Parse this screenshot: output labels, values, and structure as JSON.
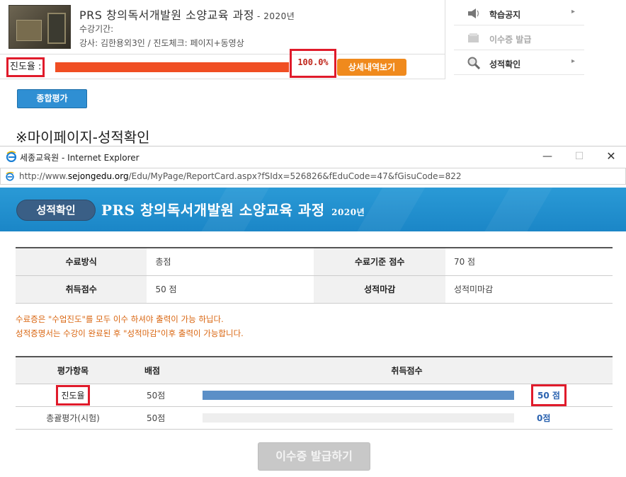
{
  "course": {
    "title": "PRS 창의독서개발원 소양교육 과정",
    "year": "- 2020년",
    "period": "수강기간:",
    "teacher": "강사: 김한용외3인 / 진도체크: 페이지+동영상",
    "progress_label": "진도율 :",
    "progress_percent": "100.0%",
    "progress_value": 100,
    "detail_button": "상세내역보기",
    "eval_button": "종합평가"
  },
  "side_menu": {
    "items": [
      {
        "label": "학습공지",
        "icon": "speaker-icon",
        "arrow": "▸"
      },
      {
        "label": "이수증 발급",
        "icon": "certificate-icon"
      },
      {
        "label": "성적확인",
        "icon": "magnifier-icon",
        "arrow": "▸"
      }
    ]
  },
  "caption": "※마이페이지-성적확인",
  "ie": {
    "window_title": "세종교육원 - Internet Explorer",
    "url_prefix": "http://www.",
    "url_domain": "sejongedu.org",
    "url_rest": "/Edu/MyPage/ReportCard.aspx?fSIdx=526826&fEduCode=47&fGisuCode=822",
    "minimize": "—",
    "maximize": "☐",
    "close": "✕"
  },
  "report": {
    "pill": "성적확인",
    "title": "PRS 창의독서개발원 소양교육 과정",
    "year": "2020년",
    "info": {
      "method_label": "수료방식",
      "method_value": "총점",
      "criteria_label": "수료기준 점수",
      "criteria_value": "70 점",
      "score_label": "취득점수",
      "score_value": "50 점",
      "closing_label": "성적마감",
      "closing_value": "성적미마감"
    },
    "notice_1": "수료증은 \"수업진도\"를 모두 이수 하셔야 출력이 가능 하닙다.",
    "notice_2": "성적증명서는 수강이 완료된 후 \"성적마감\"이후 출력이 가능합니다.",
    "table": {
      "headers": [
        "평가항목",
        "배점",
        "취득점수"
      ],
      "rows": [
        {
          "item": "진도율",
          "points": "50점",
          "score": "50 점",
          "fill": 1.0
        },
        {
          "item": "총괄평가(시험)",
          "points": "50점",
          "score": "0점",
          "fill": 0.0
        }
      ]
    },
    "issue_button": "이수증 발급하기"
  },
  "colors": {
    "progress": "#f04e23",
    "accent_orange": "#f08a1d",
    "banner": "#1b86c7",
    "score_bar": "#5b8fc7",
    "highlight": "#e01b2b"
  }
}
